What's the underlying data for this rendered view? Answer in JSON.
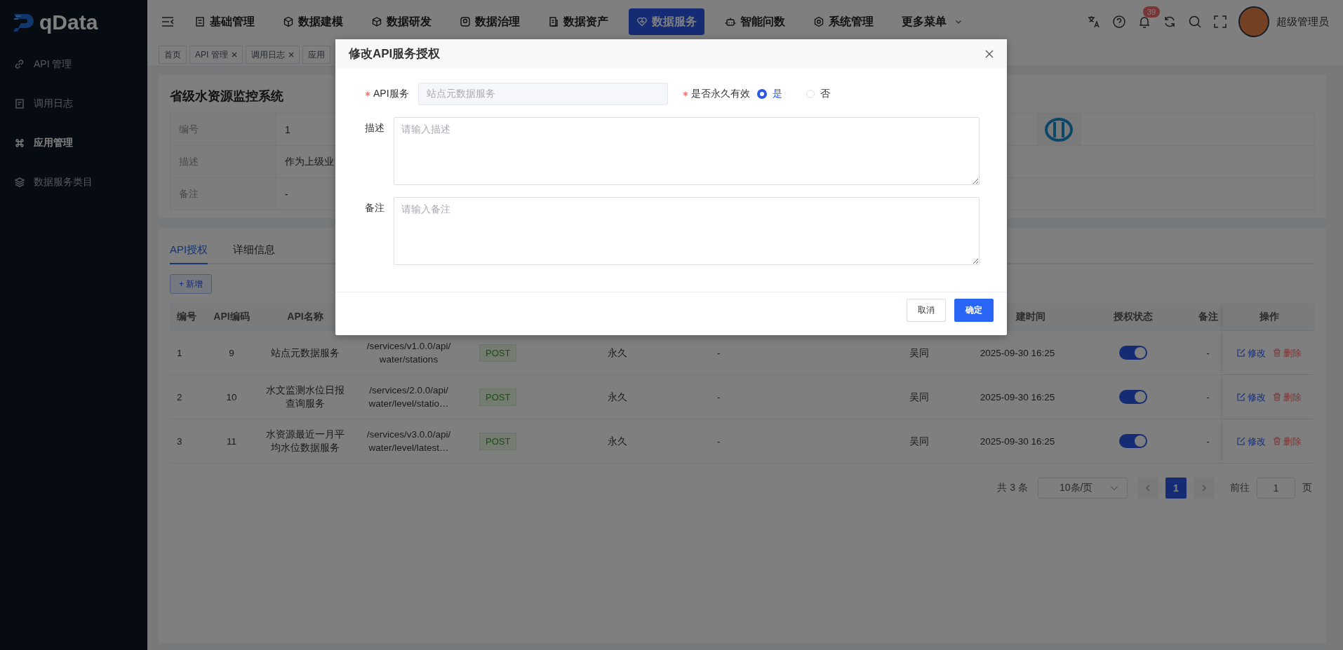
{
  "sidebar": {
    "logo": "qData",
    "items": [
      {
        "label": "API 管理",
        "selected": false
      },
      {
        "label": "调用日志",
        "selected": false
      },
      {
        "label": "应用管理",
        "selected": true
      },
      {
        "label": "数据服务类目",
        "selected": false
      }
    ]
  },
  "topbar": {
    "nav": [
      {
        "label": "基础管理",
        "selected": false
      },
      {
        "label": "数据建模",
        "selected": false
      },
      {
        "label": "数据研发",
        "selected": false
      },
      {
        "label": "数据治理",
        "selected": false
      },
      {
        "label": "数据资产",
        "selected": false
      },
      {
        "label": "数据服务",
        "selected": true
      },
      {
        "label": "智能问数",
        "selected": false
      },
      {
        "label": "系统管理",
        "selected": false
      },
      {
        "label": "更多菜单",
        "selected": false,
        "dropdown": true
      }
    ],
    "notification_count": "39",
    "user_name": "超级管理员"
  },
  "tags": [
    {
      "label": "首页",
      "closable": false
    },
    {
      "label": "API 管理",
      "closable": true
    },
    {
      "label": "调用日志",
      "closable": true
    },
    {
      "label": "应用",
      "closable": false
    }
  ],
  "app_card": {
    "title": "省级水资源监控系统",
    "rows": [
      {
        "label": "编号",
        "value": "1"
      },
      {
        "label": "描述",
        "value": "作为上级业"
      },
      {
        "label": "备注",
        "value": "-"
      }
    ]
  },
  "detail_tabs": [
    {
      "label": "API授权",
      "selected": true
    },
    {
      "label": "详细信息",
      "selected": false
    }
  ],
  "add_button": "+ 新增",
  "table": {
    "columns": [
      "编号",
      "API编码",
      "API名称",
      "建时间",
      "授权状态",
      "备注",
      "操作"
    ],
    "rows": [
      {
        "id": "1",
        "code": "9",
        "name": "站点元数据服务",
        "path": "/services/v1.0.0/api/\nwater/stations",
        "method": "POST",
        "validity": "永久",
        "column_7": "-",
        "creator": "吴同",
        "created": "2025-09-30 16:25",
        "authorized": true,
        "remark": "-",
        "actions": [
          "修改",
          "删除"
        ]
      },
      {
        "id": "2",
        "code": "10",
        "name": "水文监测水位日报查询服务",
        "path": "/services/2.0.0/api/\nwater/level/statio…",
        "method": "POST",
        "validity": "永久",
        "column_7": "-",
        "creator": "吴同",
        "created": "2025-09-30 16:25",
        "authorized": true,
        "remark": "-",
        "actions": [
          "修改",
          "删除"
        ]
      },
      {
        "id": "3",
        "code": "11",
        "name": "水资源最近一月平均水位数据服务",
        "path": "/services/v3.0.0/api/\nwater/level/latest…",
        "method": "POST",
        "validity": "永久",
        "column_7": "-",
        "creator": "吴同",
        "created": "2025-09-30 16:25",
        "authorized": true,
        "remark": "-",
        "actions": [
          "修改",
          "删除"
        ]
      }
    ]
  },
  "pagination": {
    "total": "共 3 条",
    "page_size": "10条/页",
    "pages": [
      {
        "label": "1",
        "selected": true
      }
    ],
    "jump_label": "前往",
    "jump_value": "1",
    "jump_suffix": "页"
  },
  "modal": {
    "title": "修改API服务授权",
    "api_service": {
      "label": "API服务",
      "required": true,
      "value": "站点元数据服务",
      "disabled": true
    },
    "permanent": {
      "label": "是否永久有效",
      "required": true,
      "options": [
        {
          "label": "是",
          "selected": true
        },
        {
          "label": "否",
          "selected": false
        }
      ]
    },
    "description": {
      "label": "描述",
      "placeholder": "请输入描述"
    },
    "remark": {
      "label": "备注",
      "placeholder": "请输入备注"
    },
    "buttons": [
      {
        "label": "取消",
        "kind": "secondary"
      },
      {
        "label": "确定",
        "kind": "primary"
      }
    ]
  }
}
